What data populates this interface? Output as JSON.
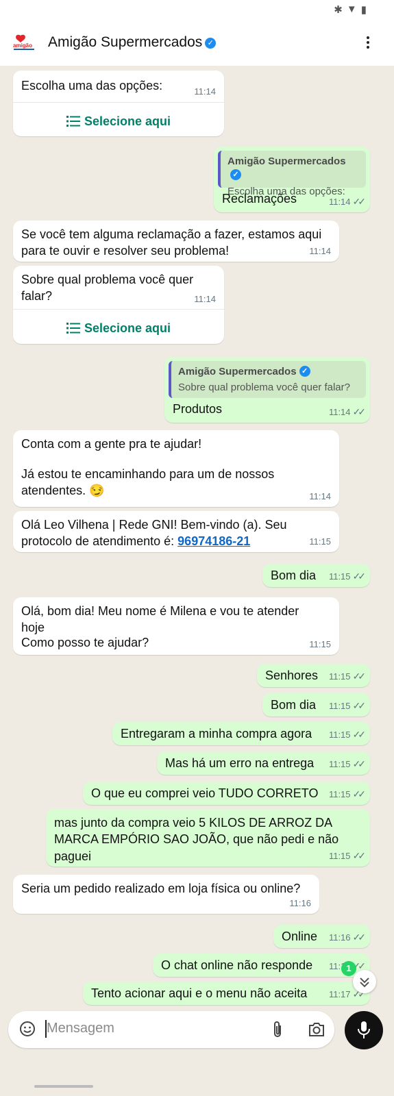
{
  "header": {
    "title": "Amigão Supermercados",
    "logo_text": "amigão"
  },
  "select_label": "Selecione aqui",
  "input": {
    "placeholder": "Mensagem"
  },
  "unread_count": "1",
  "messages": [
    {
      "text": "Escolha uma das opções:",
      "time": "11:14"
    },
    {
      "quote_name": "Amigão Supermercados",
      "quote_text": "Escolha uma das opções:",
      "text": "Reclamações",
      "time": "11:14"
    },
    {
      "text": "Se você tem alguma reclamação a fazer, estamos aqui para te ouvir e resolver seu problema!",
      "time": "11:14"
    },
    {
      "text": "Sobre qual problema você quer falar?",
      "time": "11:14"
    },
    {
      "quote_name": "Amigão Supermercados",
      "quote_text": "Sobre qual problema você quer falar?",
      "text": "Produtos",
      "time": "11:14"
    },
    {
      "text1": "Conta com a gente pra te ajudar!",
      "text2": "Já estou te encaminhando para um de nossos atendentes. 😏",
      "time": "11:14"
    },
    {
      "text": "Olá Leo Vilhena | Rede GNI! Bem-vindo (a). Seu protocolo de atendimento é:",
      "link": "96974186-21",
      "time": "11:15"
    },
    {
      "text": "Bom dia",
      "time": "11:15"
    },
    {
      "text1": "Olá, bom dia! Meu nome é Milena e vou te atender hoje",
      "text2": "Como posso te ajudar?",
      "time": "11:15"
    },
    {
      "text": "Senhores",
      "time": "11:15"
    },
    {
      "text": "Bom dia",
      "time": "11:15"
    },
    {
      "text": "Entregaram a minha compra agora",
      "time": "11:15"
    },
    {
      "text": "Mas há um erro na entrega",
      "time": "11:15"
    },
    {
      "text": "O que eu comprei veio TUDO CORRETO",
      "time": "11:15"
    },
    {
      "text": "mas junto da compra veio 5 KILOS DE ARROZ DA MARCA EMPÓRIO SAO JOÃO, que não pedi e não paguei",
      "time": "11:15"
    },
    {
      "text": "Seria um pedido realizado em loja física ou online?",
      "time": "11:16"
    },
    {
      "text": "Online",
      "time": "11:16"
    },
    {
      "text": "O chat online não responde",
      "time": "11:17"
    },
    {
      "text": "Tento acionar aqui e o menu não aceita",
      "time": "11:17"
    }
  ]
}
